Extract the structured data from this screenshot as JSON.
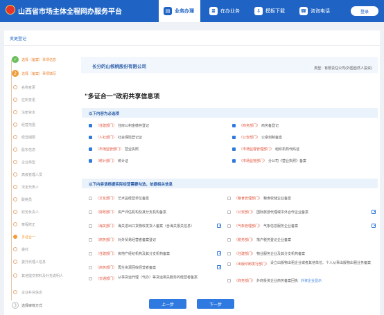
{
  "header": {
    "title": "山西省市场主体全程网办服务平台",
    "nav": [
      {
        "label": "业务办理",
        "icon": "briefcase-icon",
        "active": true
      },
      {
        "label": "在办业务",
        "icon": "document-icon",
        "active": false
      },
      {
        "label": "模板下载",
        "icon": "download-icon",
        "active": false
      },
      {
        "label": "咨询电话",
        "icon": "phone-icon",
        "active": false
      }
    ],
    "login_label": "登录"
  },
  "page": {
    "title": "变更登记"
  },
  "sidebar": {
    "steps": [
      {
        "label": "选择（备案）事项信息",
        "state": "done",
        "marker": "✓"
      },
      {
        "label": "选择（备案）事项填写",
        "state": "done",
        "marker": "2"
      },
      {
        "label": "名称变更",
        "state": "sub"
      },
      {
        "label": "住所变更",
        "state": "sub"
      },
      {
        "label": "注册资本",
        "state": "sub"
      },
      {
        "label": "经营范围",
        "state": "sub"
      },
      {
        "label": "经营期限",
        "state": "sub"
      },
      {
        "label": "股东信息",
        "state": "sub"
      },
      {
        "label": "企业类型",
        "state": "sub"
      },
      {
        "label": "高级管理人员",
        "state": "sub"
      },
      {
        "label": "法定代表人",
        "state": "sub"
      },
      {
        "label": "联络员",
        "state": "sub"
      },
      {
        "label": "财务负责人",
        "state": "sub"
      },
      {
        "label": "章程修正",
        "state": "sub"
      },
      {
        "label": "多证合一",
        "state": "current"
      },
      {
        "label": "委托",
        "state": "sub"
      },
      {
        "label": "委托代理人信息",
        "state": "sub"
      },
      {
        "label": "其他提交材料及补充说明人",
        "state": "sub"
      },
      {
        "label": "企业补充信息",
        "state": "sub"
      },
      {
        "label": "选择审核方式",
        "state": "pending",
        "marker": "3"
      }
    ]
  },
  "company": {
    "name": "长分的山核桃股份有限公司",
    "type": "类型：有限责任公司(外国自然人投资)"
  },
  "main_title": "\"多证合一\"政府共享信息项",
  "required_section": {
    "title": "以下内容为必选项",
    "items": [
      {
        "dept": "（住建部门）",
        "name": "住房公积金缴存登记",
        "checked": true
      },
      {
        "dept": "（商务部门）",
        "name": "商务备登记",
        "checked": true
      },
      {
        "dept": "（人社部门）",
        "name": "社会保险登记证",
        "checked": true
      },
      {
        "dept": "（公安部门）",
        "name": "公章刻制备案",
        "checked": true
      },
      {
        "dept": "（市场监管部门）",
        "name": "营业执照",
        "checked": true
      },
      {
        "dept": "（市场监督管理部门）",
        "name": "组织机构代码证",
        "checked": true
      },
      {
        "dept": "（统计部门）",
        "name": "统计证",
        "checked": true
      },
      {
        "dept": "（市场监管部门）",
        "name": "分公司《营业执照》备案",
        "checked": true
      }
    ]
  },
  "optional_section": {
    "title": "以下内容请根据实际经营需要勾选，依据相关信息",
    "items": [
      {
        "dept": "（文化部门）",
        "name": "艺术品经营单位备案",
        "link": "",
        "edit": false
      },
      {
        "dept": "（粮食管理部门）",
        "name": "粮食收储企业备案",
        "link": "",
        "edit": false
      },
      {
        "dept": "（财政部门）",
        "name": "资产评估机构及其分支机构备案",
        "link": "",
        "edit": false
      },
      {
        "dept": "（公安部门）",
        "name": "国际旅游代理或中外合作企业备案",
        "link": "",
        "edit": true
      },
      {
        "dept": "（海关部门）",
        "name": "海关进出口货物收发货人备案（含海关报关信息）",
        "link": "",
        "edit": true
      },
      {
        "dept": "（气象管理部门）",
        "name": "气象信息服务企业备案",
        "link": "",
        "edit": true
      },
      {
        "dept": "（商务部门）",
        "name": "对外贸易经营者备案登记",
        "link": "",
        "edit": false
      },
      {
        "dept": "（税务部门）",
        "name": "落户税务登记企业备案",
        "link": "",
        "edit": false
      },
      {
        "dept": "（住建部门）",
        "name": "房地产经纪机构及其分支机构备案",
        "link": "",
        "edit": true
      },
      {
        "dept": "（住建部门）",
        "name": "物业服务企业及其分支机构备案",
        "link": "",
        "edit": false
      },
      {
        "dept": "（商务部门）",
        "name": "再生资源回收经营者备案",
        "link": "",
        "edit": true
      },
      {
        "dept": "（出版印刷发行部门）",
        "name": "设立出版物出租企业或者其他单位、个人从事出版物出租业务备案",
        "link": "",
        "edit": false
      },
      {
        "dept": "（交通部门）",
        "name": "从事货运代理（代办）等货运相关服务的经营者备案",
        "link": "",
        "edit": false
      },
      {
        "dept": "（商务部门）",
        "name": "外商投资企业商务备案回执",
        "link": "外资企业显示",
        "edit": false
      }
    ]
  },
  "buttons": {
    "prev": "上一步",
    "next": "下一步"
  }
}
